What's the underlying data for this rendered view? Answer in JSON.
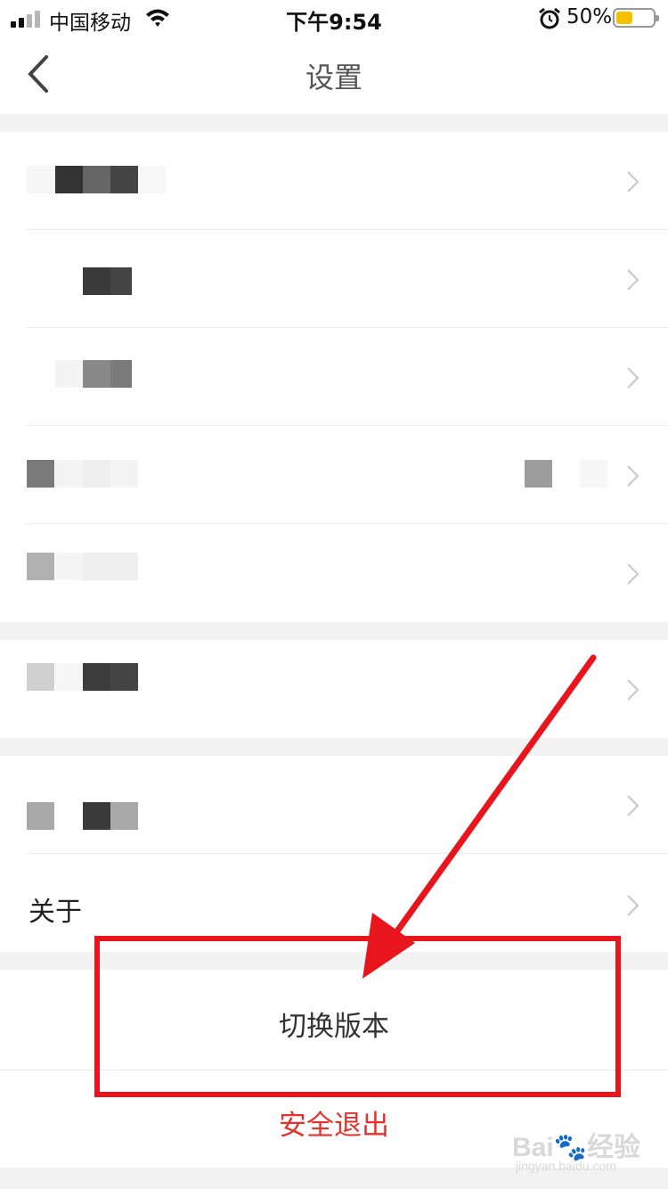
{
  "status_bar": {
    "carrier": "中国移动",
    "time": "下午9:54",
    "battery": "50%",
    "battery_level": 0.5
  },
  "nav": {
    "title": "设置",
    "back_icon": "chevron-left-icon"
  },
  "settings": {
    "about_label": "关于",
    "row_icon": "chevron-right-icon"
  },
  "actions": {
    "switch_version": "切换版本",
    "logout": "安全退出"
  },
  "colors": {
    "accent_red": "#e5322d",
    "annotation_red": "#e8161c",
    "battery_yellow": "#f5c000"
  },
  "watermark": {
    "brand": "Bai",
    "product": "经验",
    "url": "jingyan.baidu.com"
  }
}
